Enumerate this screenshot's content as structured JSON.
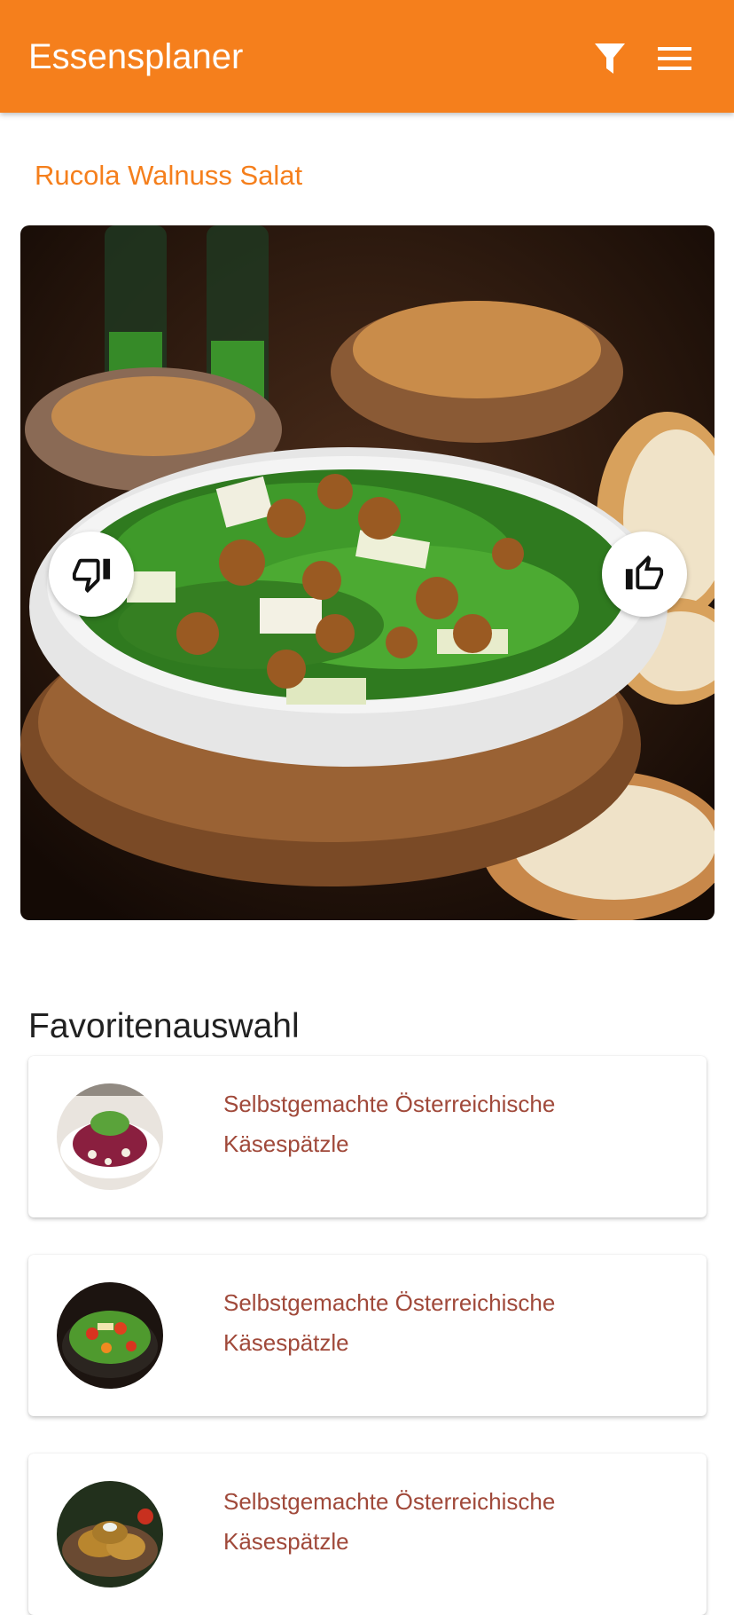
{
  "app": {
    "title": "Essensplaner"
  },
  "header_icons": {
    "filter": "filter-icon",
    "menu": "menu-icon"
  },
  "recipe": {
    "title": "Rucola Walnuss Salat",
    "image": "rucola-walnut-salad-photo",
    "dislike_icon": "thumbs-down-icon",
    "like_icon": "thumbs-up-icon"
  },
  "favorites": {
    "title": "Favoritenauswahl",
    "items": [
      {
        "name": "Selbstgemachte Österreichische Käsespätzle",
        "image": "beet-salad-photo"
      },
      {
        "name": "Selbstgemachte Österreichische Käsespätzle",
        "image": "mixed-salad-photo"
      },
      {
        "name": "Selbstgemachte Österreichische Käsespätzle",
        "image": "fritters-photo"
      }
    ]
  },
  "colors": {
    "accent": "#f57f1c",
    "favorite_text": "#a0493a"
  }
}
